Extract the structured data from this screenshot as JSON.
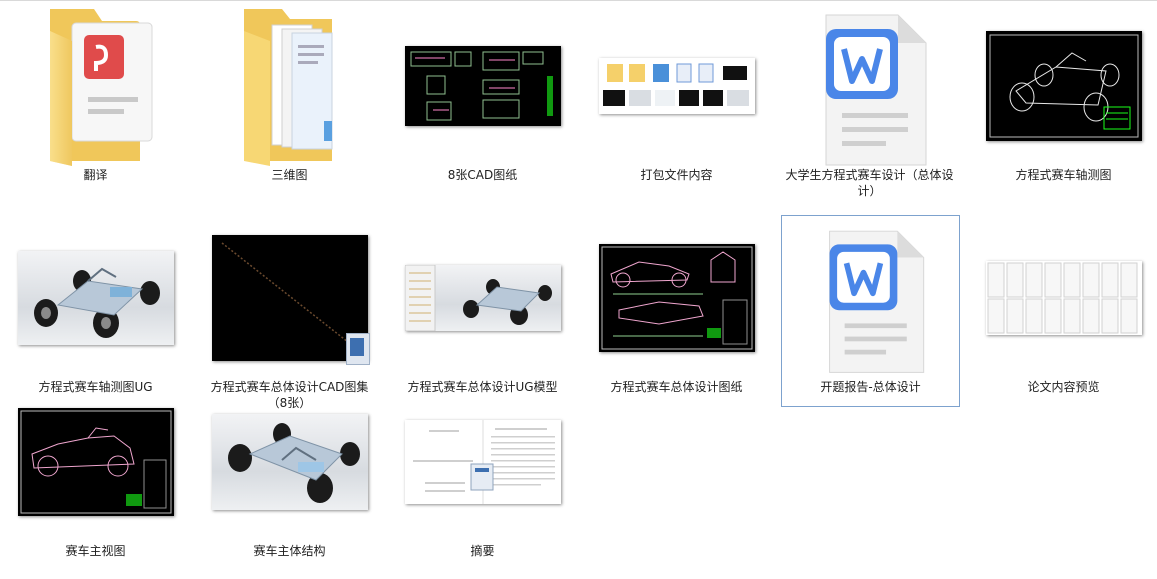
{
  "items": [
    {
      "name": "翻译",
      "icon": "folder-pdf-icon"
    },
    {
      "name": "三维图",
      "icon": "folder-docs-icon"
    },
    {
      "name": "8张CAD图纸",
      "icon": "cad-thumbnail"
    },
    {
      "name": "打包文件内容",
      "icon": "package-thumbnail"
    },
    {
      "name": "大学生方程式赛车设计（总体设计）",
      "icon": "word-doc-icon"
    },
    {
      "name": "方程式赛车轴测图",
      "icon": "cad-axonometric-thumbnail"
    },
    {
      "name": "方程式赛车轴测图UG",
      "icon": "ug-render-thumbnail"
    },
    {
      "name": "方程式赛车总体设计CAD图集（8张）",
      "icon": "cad-set-thumbnail"
    },
    {
      "name": "方程式赛车总体设计UG模型",
      "icon": "ug-model-thumbnail"
    },
    {
      "name": "方程式赛车总体设计图纸",
      "icon": "cad-drawing-thumbnail"
    },
    {
      "name": "开题报告-总体设计",
      "icon": "word-doc-icon"
    },
    {
      "name": "论文内容预览",
      "icon": "thesis-preview-thumbnail"
    },
    {
      "name": "赛车主视图",
      "icon": "cad-front-view-thumbnail"
    },
    {
      "name": "赛车主体结构",
      "icon": "ug-structure-thumbnail"
    },
    {
      "name": "摘要",
      "icon": "abstract-doc-thumbnail"
    }
  ],
  "selected_index": 10,
  "colors": {
    "word_blue": "#4a86e8",
    "folder_yellow": "#f7d774",
    "pdf_red": "#e04b4b",
    "selection_border": "#7da2ce"
  }
}
